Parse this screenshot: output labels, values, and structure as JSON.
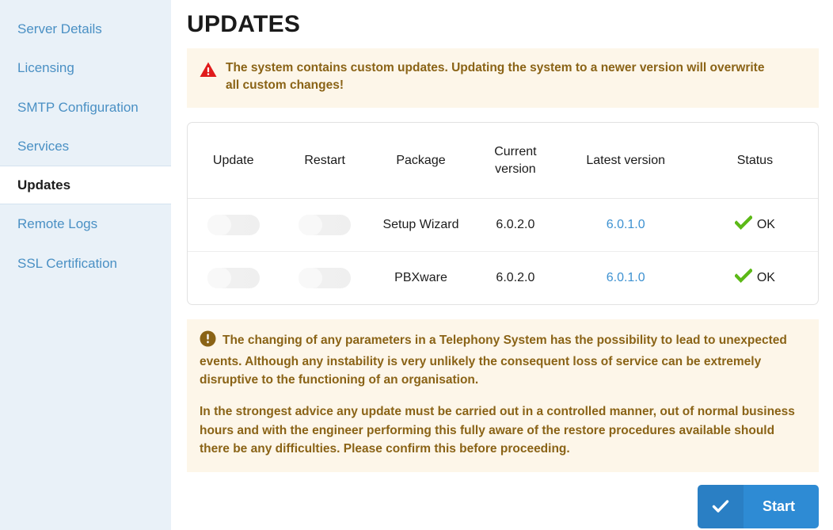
{
  "sidebar": {
    "items": [
      {
        "label": "Server Details",
        "active": false
      },
      {
        "label": "Licensing",
        "active": false
      },
      {
        "label": "SMTP Configuration",
        "active": false
      },
      {
        "label": "Services",
        "active": false
      },
      {
        "label": "Updates",
        "active": true
      },
      {
        "label": "Remote Logs",
        "active": false
      },
      {
        "label": "SSL Certification",
        "active": false
      }
    ]
  },
  "page": {
    "title": "UPDATES"
  },
  "warning_banner": {
    "icon": "warning-triangle-icon",
    "text": "The system contains custom updates. Updating the system to a newer version will overwrite all custom changes!",
    "background_color": "#FDF6E9",
    "text_color": "#8A6316",
    "icon_color": "#E01B1B"
  },
  "table": {
    "headers": [
      "Update",
      "Restart",
      "Package",
      "Current version",
      "Latest version",
      "Status"
    ],
    "rows": [
      {
        "update_toggle": "off",
        "restart_toggle": "off",
        "package": "Setup Wizard",
        "current_version": "6.0.2.0",
        "latest_version": "6.0.1.0",
        "status": "OK",
        "status_icon": "check-icon"
      },
      {
        "update_toggle": "off",
        "restart_toggle": "off",
        "package": "PBXware",
        "current_version": "6.0.2.0",
        "latest_version": "6.0.1.0",
        "status": "OK",
        "status_icon": "check-icon"
      }
    ],
    "link_color": "#3D91D1",
    "status_ok_color": "#5CB917"
  },
  "notice": {
    "icon": "info-circle-icon",
    "paragraph1": "The changing of any parameters in a Telephony System has the possibility to lead to unexpected events. Although any instability is very unlikely the consequent loss of service can be extremely disruptive to the functioning of an organisation.",
    "paragraph2": "In the strongest advice any update must be carried out in a controlled manner, out of normal business hours and with the engineer performing this fully aware of the restore procedures available should there be any difficulties. Please confirm this before proceeding.",
    "background_color": "#FDF6E9",
    "text_color": "#8A6316"
  },
  "start_button": {
    "label": "Start",
    "icon": "check-icon",
    "color": "#2E8BD4"
  }
}
